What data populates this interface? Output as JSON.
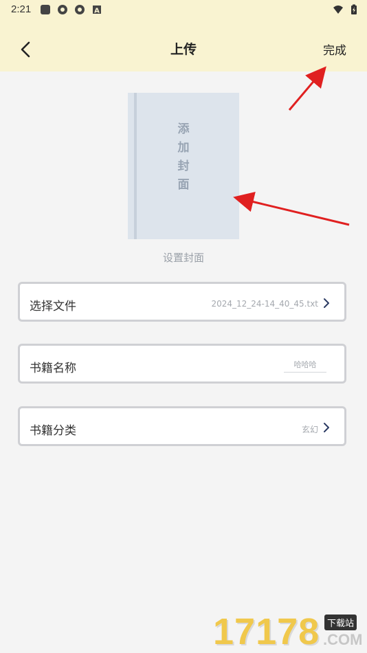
{
  "status_bar": {
    "time": "2:21"
  },
  "header": {
    "title": "上传",
    "done_label": "完成"
  },
  "cover": {
    "text": "添加封面",
    "caption": "设置封面"
  },
  "form": {
    "file": {
      "label": "选择文件",
      "value": "2024_12_24-14_40_45.txt"
    },
    "name": {
      "label": "书籍名称",
      "placeholder": "哈哈哈"
    },
    "category": {
      "label": "书籍分类",
      "value": "玄幻"
    }
  },
  "watermark": {
    "brand": "17178",
    "tag": "下载站",
    "domain": ".COM"
  },
  "colors": {
    "header_bg": "#f9f3d1",
    "cover_bg": "#dde4ec",
    "arrow": "#e02020"
  }
}
